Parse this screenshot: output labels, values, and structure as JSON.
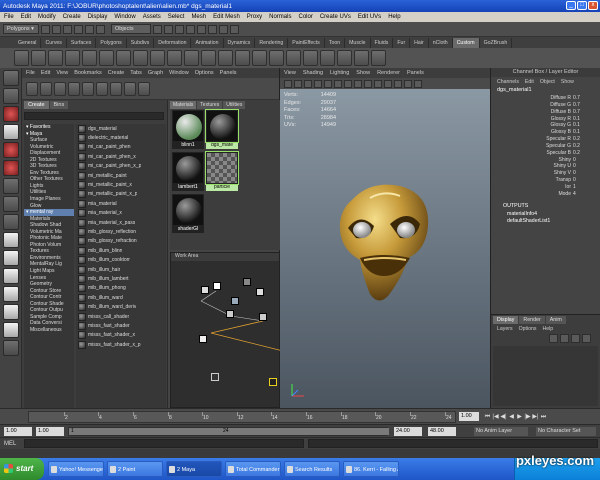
{
  "window": {
    "title": "Autodesk Maya 2011: F:\\JOBUR\\photoshoptalent\\alien\\alien.mb*    dgs_material1",
    "controls": [
      "_",
      "□",
      "x"
    ]
  },
  "menubar": [
    "File",
    "Edit",
    "Modify",
    "Create",
    "Display",
    "Window",
    "Assets",
    "Select",
    "Mesh",
    "Edit Mesh",
    "Proxy",
    "Normals",
    "Color",
    "Create UVs",
    "Edit UVs",
    "Help"
  ],
  "statusline": {
    "mode": "Polygons",
    "objects_label": "Objects"
  },
  "shelf": {
    "tabs": [
      "General",
      "Curves",
      "Surfaces",
      "Polygons",
      "Subdivs",
      "Deformation",
      "Animation",
      "Dynamics",
      "Rendering",
      "PaintEffects",
      "Toon",
      "Muscle",
      "Fluids",
      "Fur",
      "Hair",
      "nCloth",
      "Custom",
      "GoZBrush"
    ],
    "active_tab": "Custom"
  },
  "hypershade": {
    "menu": [
      "File",
      "Edit",
      "View",
      "Bookmarks",
      "Create",
      "Tabs",
      "Graph",
      "Window",
      "Options",
      "Panels"
    ],
    "create_tabs": [
      "Create",
      "Bins"
    ],
    "tree": [
      {
        "label": "Favorites",
        "cat": true
      },
      {
        "label": "Maya",
        "cat": true
      },
      {
        "label": "Surface"
      },
      {
        "label": "Volumetric"
      },
      {
        "label": "Displacement"
      },
      {
        "label": "2D Textures"
      },
      {
        "label": "3D Textures"
      },
      {
        "label": "Env Textures"
      },
      {
        "label": "Other Textures"
      },
      {
        "label": "Lights"
      },
      {
        "label": "Utilities"
      },
      {
        "label": "Image Planes"
      },
      {
        "label": "Glow"
      },
      {
        "label": "mental ray",
        "cat": true,
        "sel": true
      },
      {
        "label": "Materials"
      },
      {
        "label": "Shadow Shad"
      },
      {
        "label": "Volumetric Ma"
      },
      {
        "label": "Photonic Mate"
      },
      {
        "label": "Photon Volum"
      },
      {
        "label": "Textures"
      },
      {
        "label": "Environments"
      },
      {
        "label": "MentalRay Lig"
      },
      {
        "label": "Light Maps"
      },
      {
        "label": "Lenses"
      },
      {
        "label": "Geometry"
      },
      {
        "label": "Contour Store"
      },
      {
        "label": "Contour Contr"
      },
      {
        "label": "Contour Shade"
      },
      {
        "label": "Contour Outpu"
      },
      {
        "label": "Sample Comp"
      },
      {
        "label": "Data Conversi"
      },
      {
        "label": "Miscellaneous"
      }
    ],
    "nodes": [
      "dgs_material",
      "dielectric_material",
      "mi_car_paint_phen",
      "mi_car_paint_phen_x",
      "mi_car_paint_phen_x_p",
      "mi_metallic_paint",
      "mi_metallic_paint_x",
      "mi_metallic_paint_x_p",
      "mia_material",
      "mia_material_x",
      "mia_material_x_pass",
      "mib_glossy_reflection",
      "mib_glossy_refraction",
      "mib_illum_blinn",
      "mib_illum_cooktorr",
      "mib_illum_hair",
      "mib_illum_lambert",
      "mib_illum_phong",
      "mib_illum_ward",
      "mib_illum_ward_deriv",
      "misss_call_shader",
      "misss_fast_shader",
      "misss_fast_shader_x",
      "misss_fast_shader_x_p"
    ],
    "mat_tabs": [
      "Materials",
      "Textures",
      "Utilities"
    ],
    "materials": [
      {
        "label": "blinn1",
        "sel": false
      },
      {
        "label": "dgs_mate",
        "sel": true
      },
      {
        "label": "lambert1",
        "sel": false
      },
      {
        "label": "particle",
        "sel": true
      },
      {
        "label": "shaderGl",
        "sel": false
      }
    ],
    "workarea_title": "Work Area"
  },
  "viewport": {
    "menu": [
      "View",
      "Shading",
      "Lighting",
      "Show",
      "Renderer",
      "Panels"
    ],
    "hud": [
      {
        "k": "Verts:",
        "v": "14409"
      },
      {
        "k": "Edges:",
        "v": "29037"
      },
      {
        "k": "Faces:",
        "v": "14664"
      },
      {
        "k": "Tris:",
        "v": "28984"
      },
      {
        "k": "UVs:",
        "v": "14949"
      }
    ]
  },
  "channelbox": {
    "title": "Channel Box / Layer Editor",
    "menu": [
      "Channels",
      "Edit",
      "Object",
      "Show"
    ],
    "object": "dgs_material1",
    "attrs": [
      {
        "k": "Diffuse R",
        "v": "0.7"
      },
      {
        "k": "Diffuse G",
        "v": "0.7"
      },
      {
        "k": "Diffuse B",
        "v": "0.7"
      },
      {
        "k": "Glossy R",
        "v": "0.1"
      },
      {
        "k": "Glossy G",
        "v": "0.1"
      },
      {
        "k": "Glossy B",
        "v": "0.1"
      },
      {
        "k": "Specular R",
        "v": "0.2"
      },
      {
        "k": "Specular G",
        "v": "0.2"
      },
      {
        "k": "Specular B",
        "v": "0.2"
      },
      {
        "k": "Shiny",
        "v": "0"
      },
      {
        "k": "Shiny U",
        "v": "0"
      },
      {
        "k": "Shiny V",
        "v": "0"
      },
      {
        "k": "Transp",
        "v": "0"
      },
      {
        "k": "Ior",
        "v": "1"
      },
      {
        "k": "Mode",
        "v": "4"
      }
    ],
    "outputs_label": "OUTPUTS",
    "outputs": [
      "materialInfo4",
      "defaultShaderList1"
    ]
  },
  "layers": {
    "tabs": [
      "Display",
      "Render",
      "Anim"
    ],
    "active_tab": "Display",
    "menu": [
      "Layers",
      "Options",
      "Help"
    ]
  },
  "timeslider": {
    "ticks": [
      "2",
      "4",
      "6",
      "8",
      "10",
      "12",
      "14",
      "16",
      "18",
      "20",
      "22",
      "24"
    ],
    "current_frame": "1.00"
  },
  "rangeslider": {
    "start": "1.00",
    "playback_start": "1.00",
    "start_marker": "1",
    "end_marker": "24",
    "playback_end": "24.00",
    "end": "48.00",
    "anim_layer": "No Anim Layer",
    "character_set": "No Character Set"
  },
  "commandline": {
    "label": "MEL"
  },
  "taskbar": {
    "start": "start",
    "tasks": [
      {
        "label": "Yahoo! Messenger"
      },
      {
        "label": "2 Paint"
      },
      {
        "label": "2 Maya",
        "active": true
      },
      {
        "label": "Total Commander 6..."
      },
      {
        "label": "Search Results"
      },
      {
        "label": "86. Kerri - Falling A..."
      }
    ]
  },
  "watermark": "pxleyes.com"
}
